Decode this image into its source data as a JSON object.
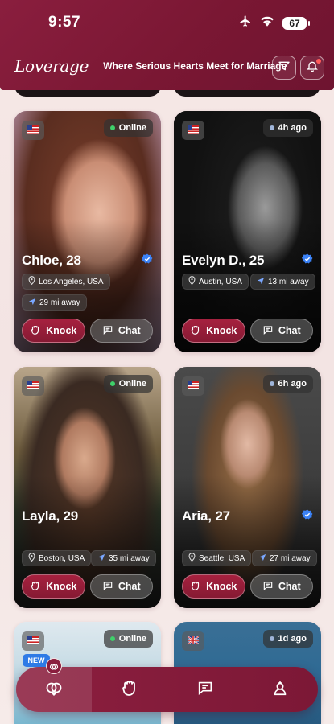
{
  "status_bar": {
    "time": "9:57",
    "battery": "67"
  },
  "header": {
    "logo": "Loverage",
    "tagline": "Where Serious Hearts Meet for Marriage",
    "filter_icon": "filter-icon",
    "bell_icon": "bell-icon"
  },
  "profiles": [
    {
      "name": "Chloe, 28",
      "status": "Online",
      "status_color": "#3fd06a",
      "flag": "us-flag",
      "location": "Los Angeles, USA",
      "distance": "29 mi away",
      "verified": true,
      "knock_label": "Knock",
      "chat_label": "Chat"
    },
    {
      "name": "Evelyn D., 25",
      "status": "4h ago",
      "status_color": "#9fb4d8",
      "flag": "us-flag",
      "location": "Austin, USA",
      "distance": "13 mi away",
      "verified": true,
      "knock_label": "Knock",
      "chat_label": "Chat"
    },
    {
      "name": "Layla, 29",
      "status": "Online",
      "status_color": "#3fd06a",
      "flag": "us-flag",
      "location": "Boston, USA",
      "distance": "35 mi away",
      "verified": false,
      "knock_label": "Knock",
      "chat_label": "Chat"
    },
    {
      "name": "Aria, 27",
      "status": "6h ago",
      "status_color": "#9fb4d8",
      "flag": "us-flag",
      "location": "Seattle, USA",
      "distance": "27 mi away",
      "verified": true,
      "knock_label": "Knock",
      "chat_label": "Chat"
    },
    {
      "status": "Online",
      "status_color": "#3fd06a",
      "flag": "us-flag"
    },
    {
      "status": "1d ago",
      "status_color": "#9fb4d8",
      "flag": "uk-flag"
    }
  ],
  "bottom_nav": {
    "new_badge": "NEW",
    "items": [
      {
        "icon": "rings-heart-icon",
        "active": true
      },
      {
        "icon": "knock-hand-icon",
        "active": false
      },
      {
        "icon": "chat-bubble-icon",
        "active": false
      },
      {
        "icon": "profile-icon",
        "active": false
      }
    ]
  },
  "colors": {
    "brand": "#8a1e3e",
    "accent_button": "#a6213f",
    "verified": "#3b82f6",
    "online": "#3fd06a"
  }
}
